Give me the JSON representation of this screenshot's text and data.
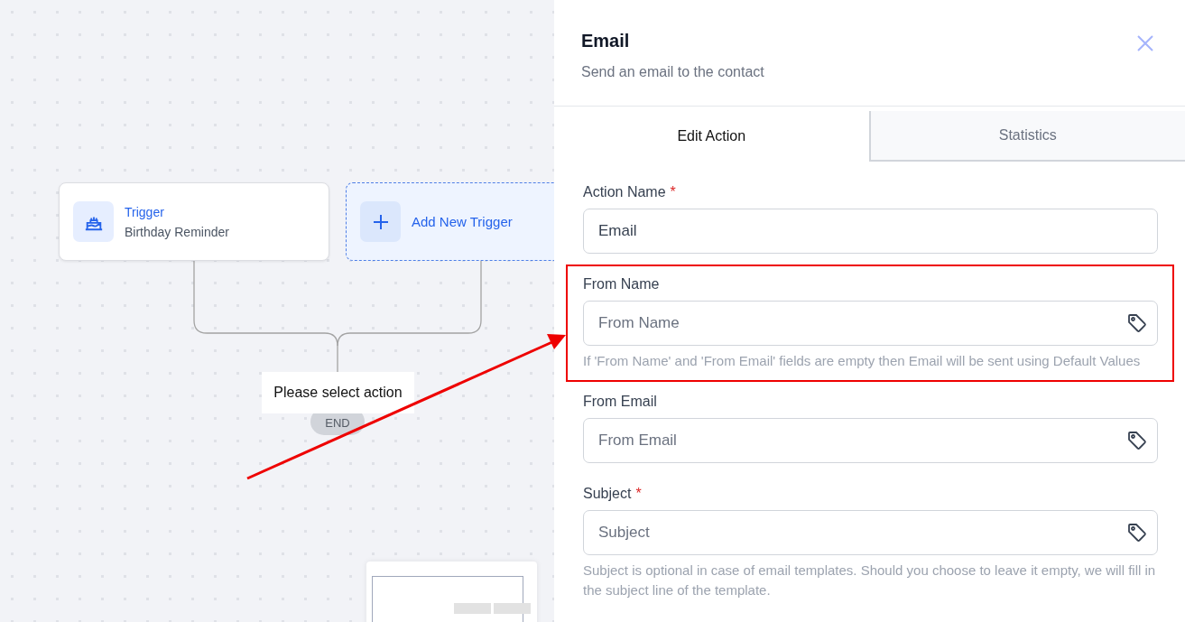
{
  "canvas": {
    "trigger": {
      "title": "Trigger",
      "subtitle": "Birthday Reminder"
    },
    "add_trigger": {
      "label": "Add New Trigger"
    },
    "action_placeholder": "Please select action",
    "end_label": "END"
  },
  "panel": {
    "title": "Email",
    "subtitle": "Send an email to the contact",
    "tabs": [
      {
        "label": "Edit Action",
        "selected": true
      },
      {
        "label": "Statistics",
        "selected": false
      }
    ],
    "fields": [
      {
        "label": "Action Name",
        "required": true,
        "value": "Email",
        "tag_icon": false,
        "highlighted": false
      },
      {
        "label": "From Name",
        "required": false,
        "placeholder": "From Name",
        "tag_icon": true,
        "hint": "If 'From Name' and 'From Email' fields are empty then Email will be sent using Default Values",
        "highlighted": true
      },
      {
        "label": "From Email",
        "required": false,
        "placeholder": "From Email",
        "tag_icon": true,
        "highlighted": false
      },
      {
        "label": "Subject",
        "required": true,
        "placeholder": "Subject",
        "tag_icon": true,
        "hint": "Subject is optional in case of email templates. Should you choose to leave it empty, we will fill in the subject line of the template.",
        "highlighted": false
      }
    ]
  },
  "required_mark": "*",
  "annotation_arrow": true
}
